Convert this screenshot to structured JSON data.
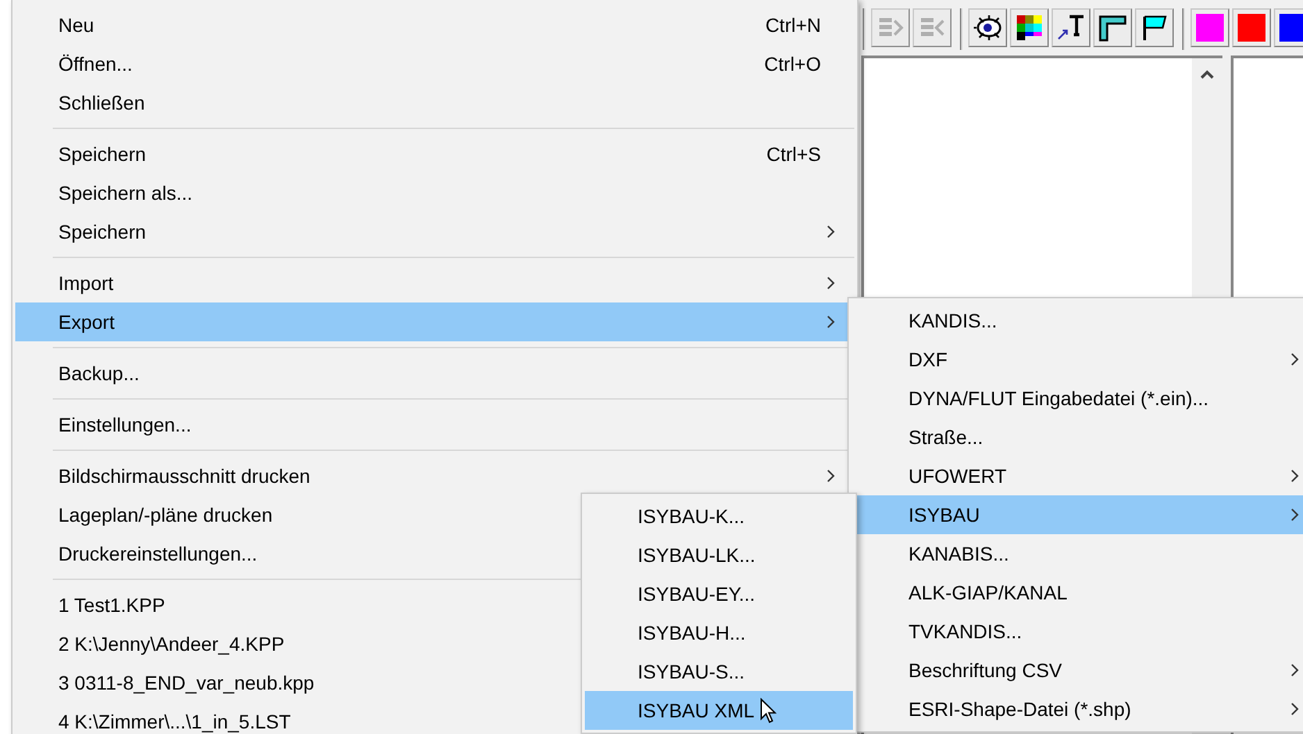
{
  "toolbar": {
    "nav_buttons": [
      {
        "disabled": true
      },
      {
        "disabled": true
      }
    ],
    "color_swatches": [
      {
        "color": "#ff00ff"
      },
      {
        "color": "#ff0000"
      },
      {
        "color": "#0000ff"
      }
    ]
  },
  "file_menu": {
    "groups": [
      [
        {
          "label": "Neu",
          "shortcut": "Ctrl+N",
          "submenu": false,
          "selected": false
        },
        {
          "label": "Öffnen...",
          "shortcut": "Ctrl+O",
          "submenu": false,
          "selected": false
        },
        {
          "label": "Schließen",
          "submenu": false,
          "selected": false
        }
      ],
      [
        {
          "label": "Speichern",
          "shortcut": "Ctrl+S",
          "submenu": false,
          "selected": false
        },
        {
          "label": "Speichern als...",
          "submenu": false,
          "selected": false
        },
        {
          "label": "Speichern",
          "submenu": true,
          "selected": false
        }
      ],
      [
        {
          "label": "Import",
          "submenu": true,
          "selected": false
        },
        {
          "label": "Export",
          "submenu": true,
          "selected": true
        }
      ],
      [
        {
          "label": "Backup...",
          "submenu": false,
          "selected": false
        }
      ],
      [
        {
          "label": "Einstellungen...",
          "submenu": false,
          "selected": false
        }
      ],
      [
        {
          "label": "Bildschirmausschnitt drucken",
          "submenu": true,
          "selected": false
        },
        {
          "label": "Lageplan/-pläne drucken",
          "selected": false
        },
        {
          "label": "Druckereinstellungen...",
          "selected": false
        }
      ],
      [
        {
          "label": "1 Test1.KPP",
          "selected": false
        },
        {
          "label": "2 K:\\Jenny\\Andeer_4.KPP",
          "selected": false
        },
        {
          "label": "3 0311-8_END_var_neub.kpp",
          "selected": false
        },
        {
          "label": "4 K:\\Zimmer\\...\\1_in_5.LST",
          "selected": false
        }
      ]
    ]
  },
  "export_menu": {
    "items": [
      {
        "label": "KANDIS...",
        "submenu": false,
        "selected": false
      },
      {
        "label": "DXF",
        "submenu": true,
        "selected": false
      },
      {
        "label": "DYNA/FLUT Eingabedatei (*.ein)...",
        "submenu": false,
        "selected": false
      },
      {
        "label": "Straße...",
        "submenu": false,
        "selected": false
      },
      {
        "label": "UFOWERT",
        "submenu": true,
        "selected": false
      },
      {
        "label": "ISYBAU",
        "submenu": true,
        "selected": true
      },
      {
        "label": "KANABIS...",
        "submenu": false,
        "selected": false
      },
      {
        "label": "ALK-GIAP/KANAL",
        "submenu": false,
        "selected": false
      },
      {
        "label": "TVKANDIS...",
        "submenu": false,
        "selected": false
      },
      {
        "label": "Beschriftung CSV",
        "submenu": true,
        "selected": false
      },
      {
        "label": "ESRI-Shape-Datei (*.shp)",
        "submenu": true,
        "selected": false
      }
    ]
  },
  "isybau_menu": {
    "items": [
      {
        "label": "ISYBAU-K...",
        "selected": false
      },
      {
        "label": "ISYBAU-LK...",
        "selected": false
      },
      {
        "label": "ISYBAU-EY...",
        "selected": false
      },
      {
        "label": "ISYBAU-H...",
        "selected": false
      },
      {
        "label": "ISYBAU-S...",
        "selected": false
      },
      {
        "label": "ISYBAU XML",
        "selected": true
      }
    ]
  }
}
